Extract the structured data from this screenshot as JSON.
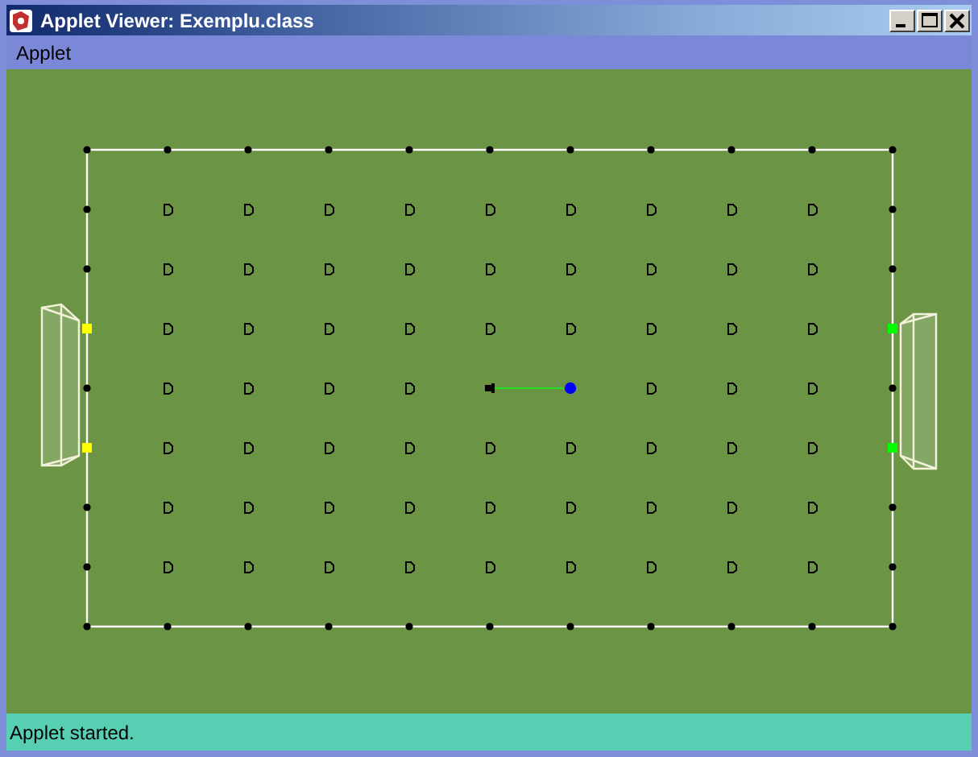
{
  "window": {
    "title": "Applet Viewer: Exemplu.class"
  },
  "menu": [
    "Applet"
  ],
  "goals": [
    {
      "color": "#ffff00"
    },
    {
      "color": "#00ff00"
    }
  ],
  "ball": {
    "color": "#0000ff"
  },
  "status_bar": "Applet started."
}
